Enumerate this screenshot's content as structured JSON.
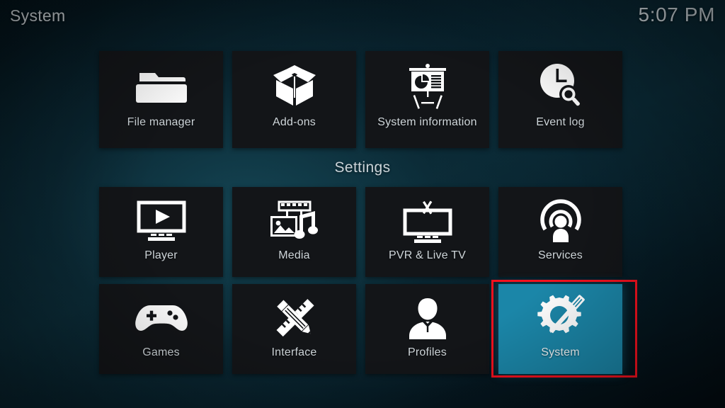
{
  "header": {
    "title": "System",
    "clock": "5:07 PM"
  },
  "section": {
    "settings_label": "Settings"
  },
  "colors": {
    "tile_background": "#131518",
    "tile_selected_background": "#1b86a8",
    "annotation_border": "#f4111e",
    "label_text": "#cfd6da",
    "icon_fill": "#ffffff"
  },
  "top_row": [
    {
      "label": "File manager",
      "icon": "folder-icon",
      "selected": false
    },
    {
      "label": "Add-ons",
      "icon": "open-box-icon",
      "selected": false
    },
    {
      "label": "System information",
      "icon": "presentation-chart-icon",
      "selected": false
    },
    {
      "label": "Event log",
      "icon": "clock-search-icon",
      "selected": false
    }
  ],
  "settings_row_one": [
    {
      "label": "Player",
      "icon": "monitor-play-icon",
      "selected": false
    },
    {
      "label": "Media",
      "icon": "film-photo-music-icon",
      "selected": false
    },
    {
      "label": "PVR & Live TV",
      "icon": "tv-antenna-icon",
      "selected": false
    },
    {
      "label": "Services",
      "icon": "broadcast-person-icon",
      "selected": false
    }
  ],
  "settings_row_two": [
    {
      "label": "Games",
      "icon": "gamepad-icon",
      "selected": false
    },
    {
      "label": "Interface",
      "icon": "pencil-ruler-icon",
      "selected": false
    },
    {
      "label": "Profiles",
      "icon": "person-bust-icon",
      "selected": false
    },
    {
      "label": "System",
      "icon": "gear-screwdriver-icon",
      "selected": true
    }
  ]
}
